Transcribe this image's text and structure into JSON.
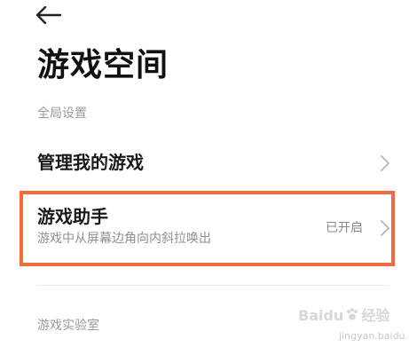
{
  "header": {
    "back_icon": "arrow-left-icon",
    "title": "游戏空间"
  },
  "sections": {
    "global_settings_label": "全局设置",
    "lab_label": "游戏实验室"
  },
  "rows": {
    "manage_games": {
      "title": "管理我的游戏",
      "icon": "chevron-right-icon"
    },
    "game_assistant": {
      "title": "游戏助手",
      "subtitle": "游戏中从屏幕边角向内斜拉唤出",
      "status": "已开启",
      "icon": "chevron-right-icon"
    }
  },
  "annotation": {
    "highlight_color": "#f26a3d"
  },
  "watermark": {
    "brand_text": "Baidu",
    "brand_suffix": "经验",
    "url": "jingyan.baidu.com"
  },
  "colors": {
    "title": "#111111",
    "secondary_text": "#9a9a9a",
    "chevron": "#b5b5b5"
  }
}
